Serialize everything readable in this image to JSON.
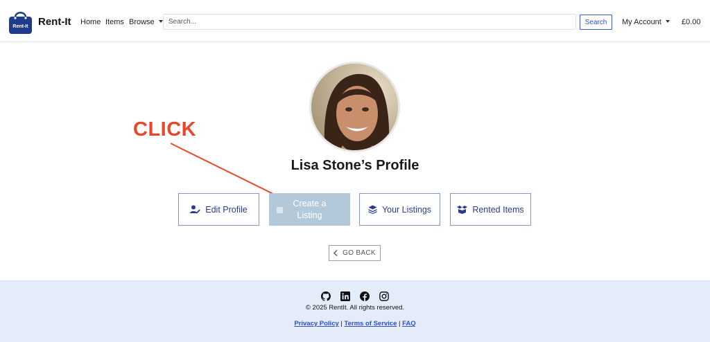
{
  "nav": {
    "brand": "Rent-It",
    "logo_text": "Rent-It",
    "home": "Home",
    "items": "Items",
    "browse": "Browse",
    "search_placeholder": "Search...",
    "search_button": "Search",
    "account": "My Account",
    "cart_total": "£0.00"
  },
  "profile": {
    "title": "Lisa Stone’s Profile",
    "actions": {
      "edit": "Edit Profile",
      "create": "Create a Listing",
      "listings": "Your Listings",
      "rented": "Rented Items"
    },
    "go_back": "GO BACK"
  },
  "annotation": {
    "label": "CLICK",
    "color": "#e8472b"
  },
  "footer": {
    "copyright": "© 2025 RentIt. All rights reserved.",
    "links": {
      "privacy": "Privacy Policy",
      "terms": "Terms of Service",
      "faq": "FAQ"
    },
    "separator": "|",
    "social_icons": [
      "github-icon",
      "linkedin-icon",
      "facebook-icon",
      "instagram-icon"
    ]
  },
  "colors": {
    "brand_blue": "#2b4fd1",
    "create_button_bg": "#b3c8d8",
    "footer_bg": "#e4ecfa"
  }
}
